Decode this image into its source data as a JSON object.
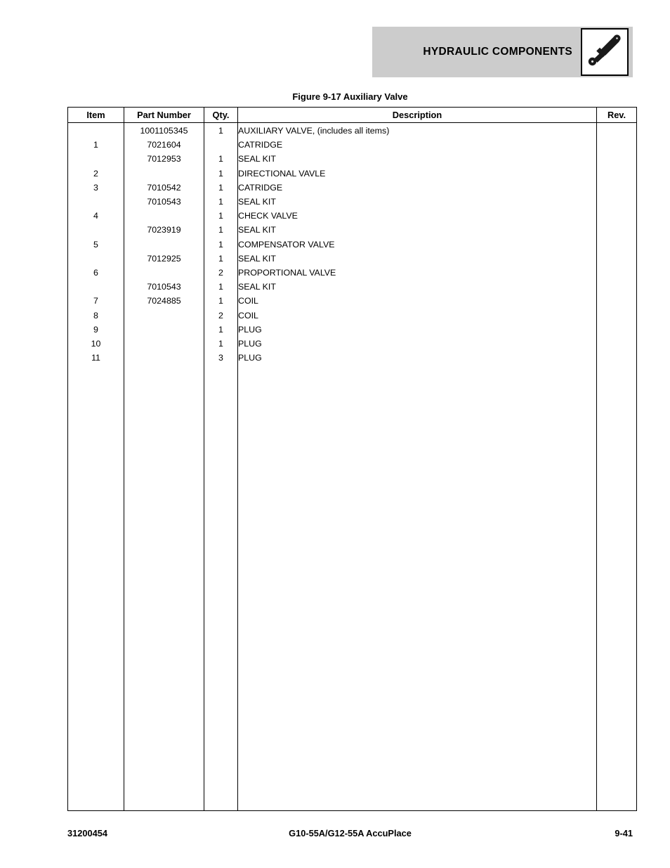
{
  "header": {
    "title": "HYDRAULIC COMPONENTS",
    "icon": "hydraulic-cylinder-icon",
    "band_color": "#cccccc"
  },
  "figure": {
    "caption": "Figure 9-17 Auxiliary Valve"
  },
  "table": {
    "columns": {
      "item": "Item",
      "part_number": "Part Number",
      "qty": "Qty.",
      "description": "Description",
      "rev": "Rev."
    },
    "rows": [
      {
        "item": "",
        "part_number": "1001105345",
        "qty": "1",
        "description": "AUXILIARY VALVE, (includes all items)",
        "indent": 0,
        "rev": ""
      },
      {
        "item": "1",
        "part_number": "7021604",
        "qty": "",
        "description": "CATRIDGE",
        "indent": 1,
        "rev": ""
      },
      {
        "item": "",
        "part_number": "7012953",
        "qty": "1",
        "description": "SEAL KIT",
        "indent": 2,
        "rev": ""
      },
      {
        "item": "2",
        "part_number": "",
        "qty": "1",
        "description": "DIRECTIONAL VAVLE",
        "indent": 1,
        "rev": ""
      },
      {
        "item": "3",
        "part_number": "7010542",
        "qty": "1",
        "description": "CATRIDGE",
        "indent": 1,
        "rev": ""
      },
      {
        "item": "",
        "part_number": "7010543",
        "qty": "1",
        "description": "SEAL KIT",
        "indent": 2,
        "rev": ""
      },
      {
        "item": "4",
        "part_number": "",
        "qty": "1",
        "description": "CHECK VALVE",
        "indent": 1,
        "rev": ""
      },
      {
        "item": "",
        "part_number": "7023919",
        "qty": "1",
        "description": "SEAL KIT",
        "indent": 2,
        "rev": ""
      },
      {
        "item": "5",
        "part_number": "",
        "qty": "1",
        "description": "COMPENSATOR VALVE",
        "indent": 1,
        "rev": ""
      },
      {
        "item": "",
        "part_number": "7012925",
        "qty": "1",
        "description": "SEAL KIT",
        "indent": 2,
        "rev": ""
      },
      {
        "item": "6",
        "part_number": "",
        "qty": "2",
        "description": "PROPORTIONAL VALVE",
        "indent": 1,
        "rev": ""
      },
      {
        "item": "",
        "part_number": "7010543",
        "qty": "1",
        "description": "SEAL KIT",
        "indent": 2,
        "rev": ""
      },
      {
        "item": "7",
        "part_number": "7024885",
        "qty": "1",
        "description": "COIL",
        "indent": 1,
        "rev": ""
      },
      {
        "item": "8",
        "part_number": "",
        "qty": "2",
        "description": "COIL",
        "indent": 1,
        "rev": ""
      },
      {
        "item": "9",
        "part_number": "",
        "qty": "1",
        "description": "PLUG",
        "indent": 1,
        "rev": ""
      },
      {
        "item": "10",
        "part_number": "",
        "qty": "1",
        "description": "PLUG",
        "indent": 1,
        "rev": ""
      },
      {
        "item": "11",
        "part_number": "",
        "qty": "3",
        "description": "PLUG",
        "indent": 1,
        "rev": ""
      }
    ]
  },
  "footer": {
    "document_number": "31200454",
    "model": "G10-55A/G12-55A AccuPlace",
    "page": "9-41"
  }
}
